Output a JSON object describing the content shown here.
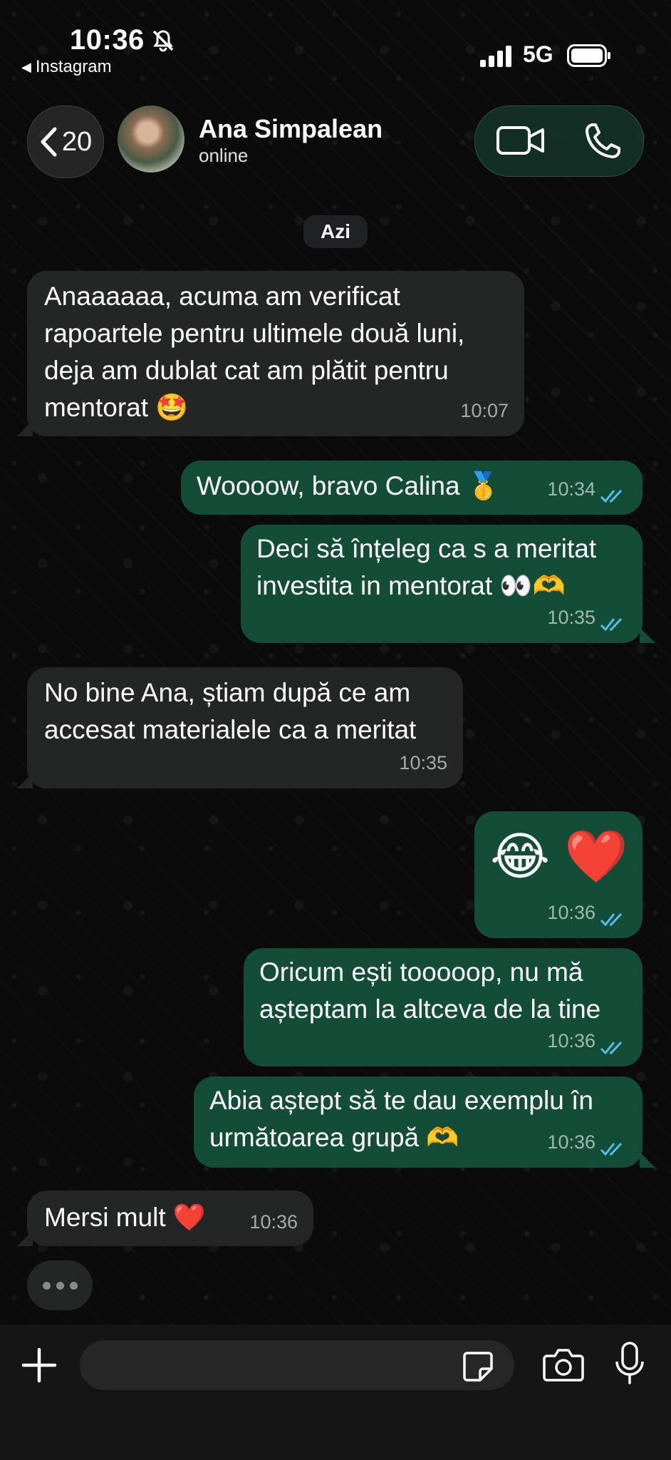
{
  "status_bar": {
    "time": "10:36",
    "back_app": "Instagram",
    "network": "5G",
    "icons": [
      "bell-slash-icon",
      "signal-icon",
      "battery-icon"
    ]
  },
  "header": {
    "back_count": "20",
    "contact_name": "Ana Simpalean",
    "contact_status": "online",
    "icons": [
      "chevron-left-icon",
      "video-call-icon",
      "phone-icon"
    ]
  },
  "date_divider": "Azi",
  "messages": [
    {
      "direction": "in",
      "lines": [
        "Anaaaaaa, acuma am verificat",
        "rapoartele pentru ultimele două luni,",
        "deja am dublat cat am plătit pentru",
        "mentorat 🤩"
      ],
      "time": "10:07"
    },
    {
      "direction": "out",
      "lines": [
        "Woooow, bravo Calina 🥇"
      ],
      "time": "10:34",
      "read": true
    },
    {
      "direction": "out",
      "lines": [
        "Deci să înțeleg ca s a meritat",
        "investita in mentorat 👀🫶"
      ],
      "time": "10:35",
      "read": true
    },
    {
      "direction": "in",
      "lines": [
        "No bine Ana, știam după ce am",
        "accesat materialele ca a meritat"
      ],
      "time": "10:35"
    },
    {
      "direction": "out",
      "lines": [
        "😂 ❤️"
      ],
      "time": "10:36",
      "read": true
    },
    {
      "direction": "out",
      "lines": [
        "Oricum ești tooooop, nu mă",
        "așteptam la altceva de la tine"
      ],
      "time": "10:36",
      "read": true
    },
    {
      "direction": "out",
      "lines": [
        "Abia aștept să te dau exemplu în",
        "următoarea grupă 🫶"
      ],
      "time": "10:36",
      "read": true
    },
    {
      "direction": "in",
      "lines": [
        "Mersi mult ❤️"
      ],
      "time": "10:36"
    }
  ],
  "typing_indicator": true,
  "composer": {
    "placeholder": "",
    "icons": [
      "plus-icon",
      "sticker-icon",
      "camera-icon",
      "microphone-icon"
    ]
  },
  "colors": {
    "incoming_bubble": "#242626",
    "outgoing_bubble": "#134d37",
    "read_tick": "#53bdeb",
    "background": "#0b0b0b"
  }
}
